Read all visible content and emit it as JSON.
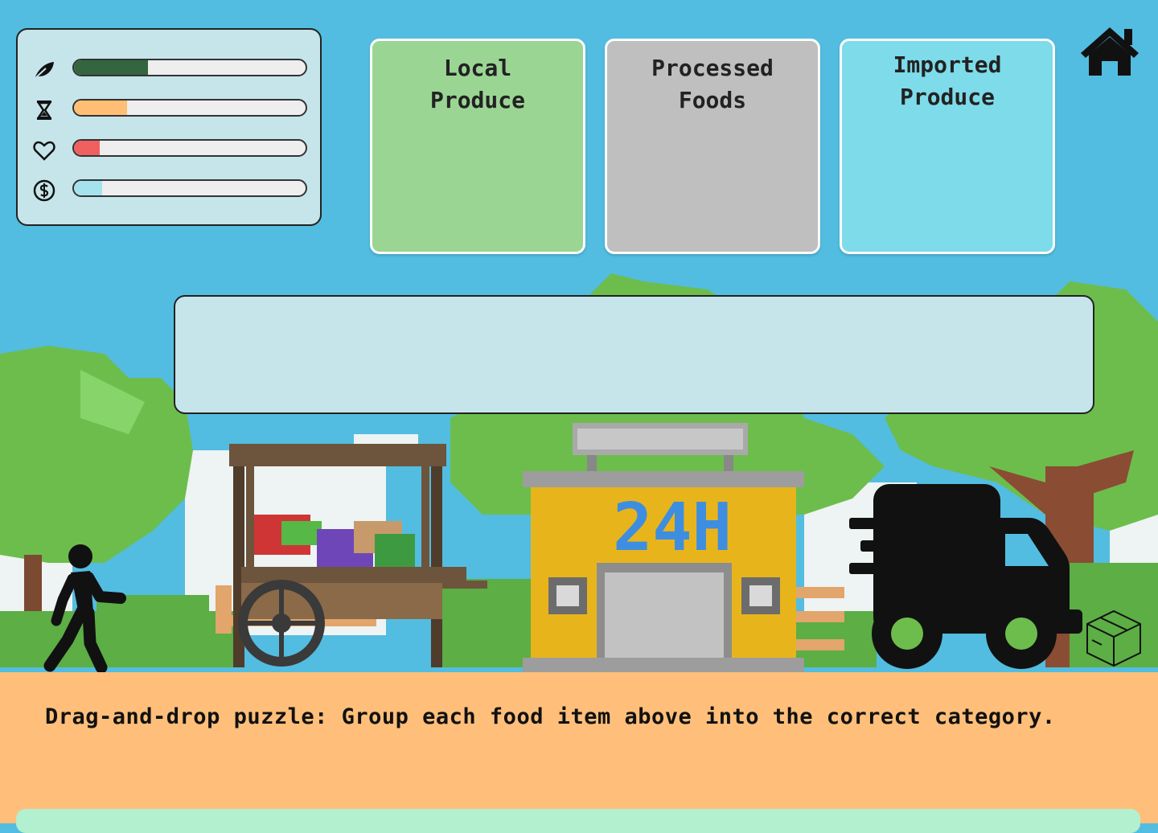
{
  "stats": [
    {
      "icon": "leaf-icon",
      "label": "Sustainability",
      "level": 0.32,
      "color": "#33653f"
    },
    {
      "icon": "hourglass-icon",
      "label": "Time",
      "level": 0.23,
      "color": "#ffbe74"
    },
    {
      "icon": "heart-icon",
      "label": "Health",
      "level": 0.11,
      "color": "#f0605e"
    },
    {
      "icon": "money-icon",
      "label": "Money",
      "level": 0.12,
      "color": "#a4e3ee"
    }
  ],
  "categories": [
    {
      "label": "Local Produce",
      "color": "#9ad594"
    },
    {
      "label": "Processed Foods",
      "color": "#bfbfbf"
    },
    {
      "label": "Imported Produce",
      "color": "#7edbea"
    }
  ],
  "home": {
    "icon": "home-icon"
  },
  "scene": {
    "kiosk_sign": "24H"
  },
  "dialogue": {
    "text": "Drag-and-drop puzzle: Group each food item above into the correct category."
  }
}
